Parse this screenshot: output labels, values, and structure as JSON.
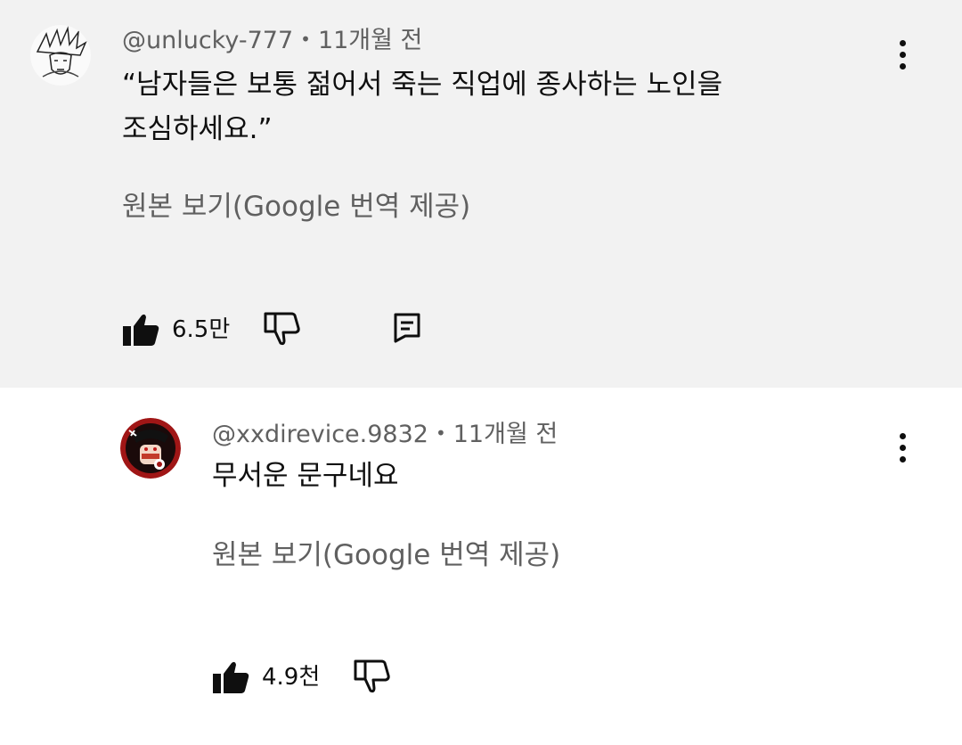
{
  "comments": [
    {
      "author": "@unlucky-777",
      "separator": "•",
      "time": "11개월 전",
      "text": "“남자들은 보통 젊어서 죽는 직업에 종사하는 노인을\n조심하세요.”",
      "translate_label": "원본 보기(Google 번역 제공)",
      "like_count": "6.5만",
      "icons": {
        "like": "thumbs-up-filled-icon",
        "dislike": "thumbs-down-outline-icon",
        "reply": "comment-icon",
        "more": "vertical-dots-icon"
      }
    },
    {
      "author": "@xxdirevice.9832",
      "separator": "•",
      "time": "11개월 전",
      "text": "무서운 문구네요",
      "translate_label": "원본 보기(Google 번역 제공)",
      "like_count": "4.9천",
      "icons": {
        "like": "thumbs-up-filled-icon",
        "dislike": "thumbs-down-outline-icon",
        "more": "vertical-dots-icon"
      }
    }
  ],
  "colors": {
    "highlight_bg": "#f2f2f2",
    "primary_text": "#0f0f0f",
    "secondary_text": "#606060"
  }
}
